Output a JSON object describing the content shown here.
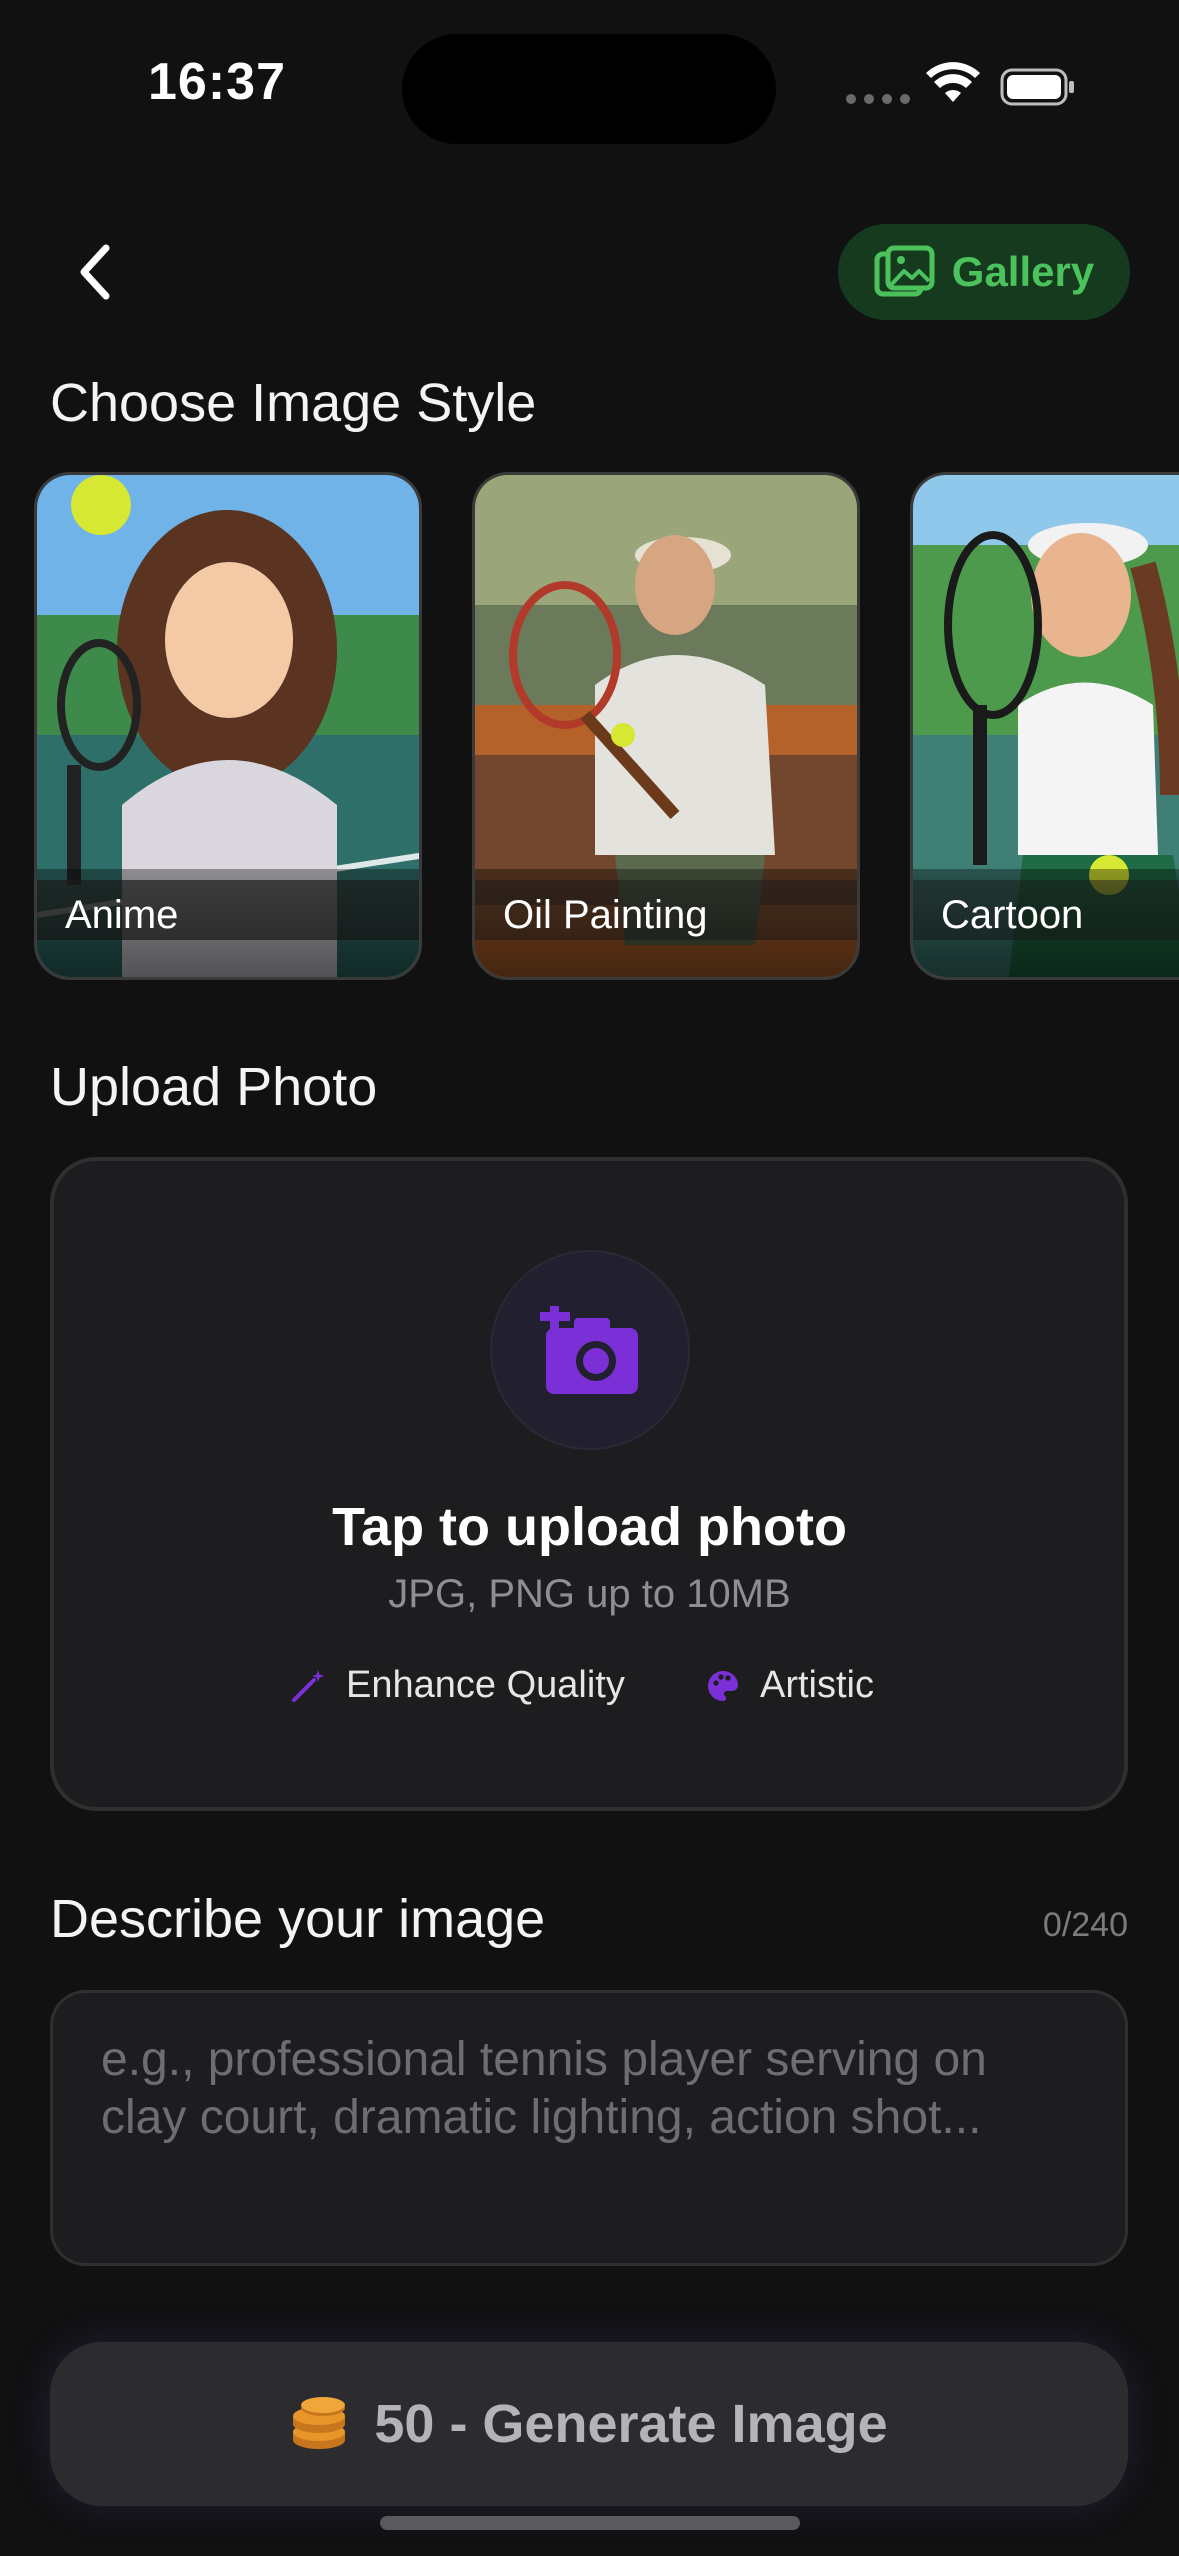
{
  "status_bar": {
    "time": "16:37"
  },
  "header": {
    "gallery_label": "Gallery"
  },
  "styles": {
    "title": "Choose Image Style",
    "items": [
      {
        "label": "Anime"
      },
      {
        "label": "Oil Painting"
      },
      {
        "label": "Cartoon"
      }
    ]
  },
  "upload": {
    "title": "Upload Photo",
    "cta": "Tap to upload photo",
    "hint": "JPG, PNG up to 10MB",
    "features": [
      "Enhance Quality",
      "Artistic"
    ]
  },
  "description": {
    "title": "Describe your image",
    "counter": "0/240",
    "placeholder": "e.g., professional tennis player serving on clay court, dramatic lighting, action shot..."
  },
  "generate": {
    "label": "50 - Generate Image"
  },
  "colors": {
    "accent_green": "#4cc25d",
    "accent_purple": "#7b2fd6",
    "coin": "#e8962a"
  }
}
